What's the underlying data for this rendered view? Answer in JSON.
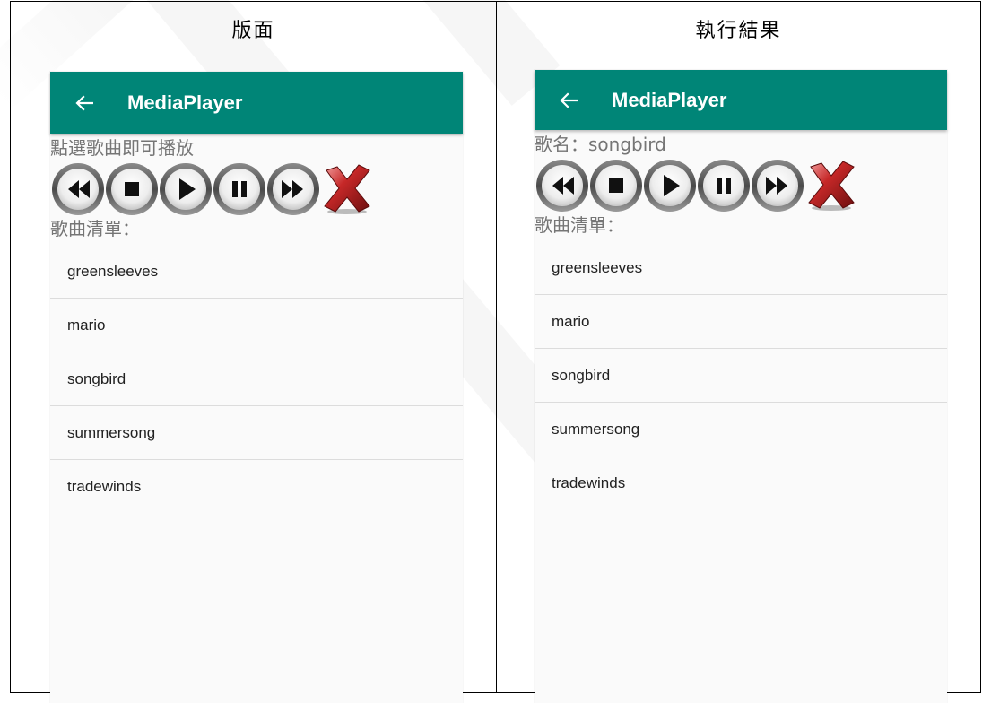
{
  "headers": {
    "left": "版面",
    "right": "執行結果"
  },
  "left_phone": {
    "app_title": "MediaPlayer",
    "status_text": "點選歌曲即可播放",
    "list_title": "歌曲清單：",
    "songs": [
      "greensleeves",
      "mario",
      "songbird",
      "summersong",
      "tradewinds"
    ]
  },
  "right_phone": {
    "app_title": "MediaPlayer",
    "status_text": "歌名：songbird",
    "list_title": "歌曲清單：",
    "songs": [
      "greensleeves",
      "mario",
      "songbird",
      "summersong",
      "tradewinds"
    ]
  },
  "controls": [
    "rewind-icon",
    "stop-icon",
    "play-icon",
    "pause-icon",
    "fast-forward-icon",
    "close-icon"
  ],
  "colors": {
    "app_bar": "#008577",
    "close_red": "#b71c1c",
    "secondary_text": "#757575"
  }
}
